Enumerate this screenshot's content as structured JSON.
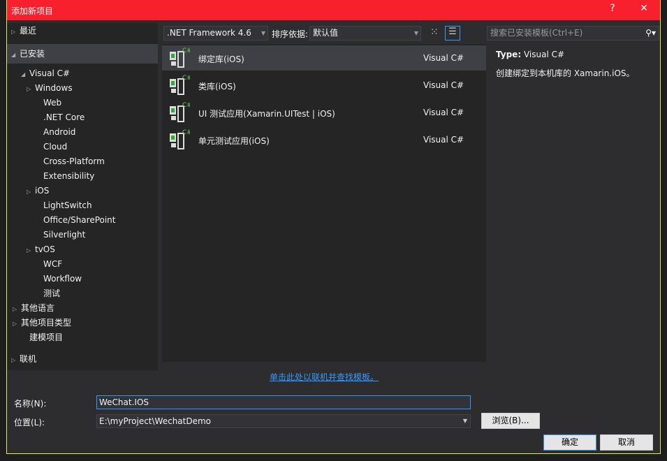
{
  "title": "添加新项目",
  "title_buttons": {
    "help": "?",
    "close": "✕"
  },
  "tree": [
    {
      "label": "最近",
      "arrow": "▷"
    },
    {
      "label": "已安装",
      "arrow": "◢"
    },
    {
      "label": "Visual C#",
      "arrow": "◢"
    },
    {
      "label": "Windows",
      "arrow": "▷"
    },
    {
      "label": "Web",
      "arrow": ""
    },
    {
      "label": ".NET Core",
      "arrow": ""
    },
    {
      "label": "Android",
      "arrow": ""
    },
    {
      "label": "Cloud",
      "arrow": ""
    },
    {
      "label": "Cross-Platform",
      "arrow": ""
    },
    {
      "label": "Extensibility",
      "arrow": ""
    },
    {
      "label": "iOS",
      "arrow": "▷"
    },
    {
      "label": "LightSwitch",
      "arrow": ""
    },
    {
      "label": "Office/SharePoint",
      "arrow": ""
    },
    {
      "label": "Silverlight",
      "arrow": ""
    },
    {
      "label": "tvOS",
      "arrow": "▷"
    },
    {
      "label": "WCF",
      "arrow": ""
    },
    {
      "label": "Workflow",
      "arrow": ""
    },
    {
      "label": "测试",
      "arrow": ""
    },
    {
      "label": "其他语言",
      "arrow": "▷"
    },
    {
      "label": "其他项目类型",
      "arrow": "▷"
    },
    {
      "label": "建模项目",
      "arrow": ""
    },
    {
      "label": "联机",
      "arrow": "▷"
    }
  ],
  "toolbar": {
    "framework": ".NET Framework 4.6",
    "sort_label": "排序依据:",
    "sort_value": "默认值"
  },
  "search": {
    "placeholder": "搜索已安装模板(Ctrl+E)"
  },
  "templates": [
    {
      "name": "绑定库(iOS)",
      "lang": "Visual C#",
      "selected": true
    },
    {
      "name": "类库(iOS)",
      "lang": "Visual C#"
    },
    {
      "name": "UI 测试应用(Xamarin.UITest | iOS)",
      "lang": "Visual C#"
    },
    {
      "name": "单元测试应用(iOS)",
      "lang": "Visual C#"
    }
  ],
  "detail": {
    "type_label": "Type:",
    "type_value": "Visual C#",
    "description": "创建绑定到本机库的 Xamarin.iOS。"
  },
  "online_link": "单击此处以联机并查找模板。",
  "form": {
    "name_label": "名称(N):",
    "name_value": "WeChat.IOS",
    "location_label": "位置(L):",
    "location_value": "E:\\myProject\\WechatDemo",
    "browse": "浏览(B)...",
    "ok": "确定",
    "cancel": "取消"
  },
  "colors": {
    "titlebar": "#f8202c",
    "link": "#3399ff",
    "selection": "#3f3f46"
  }
}
